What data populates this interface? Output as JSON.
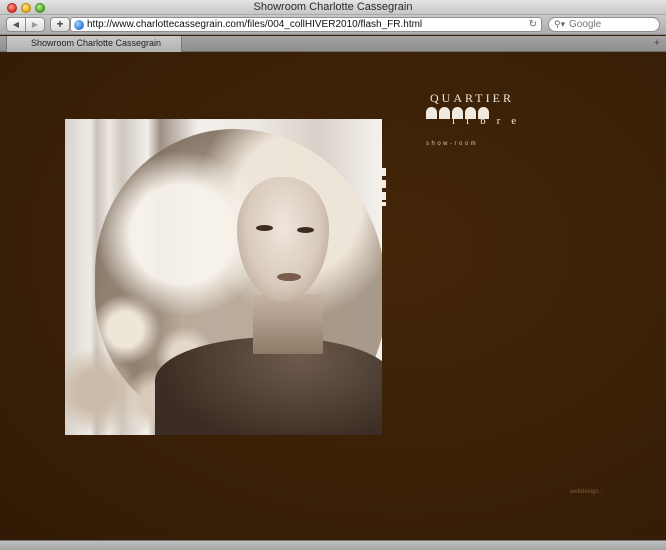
{
  "window": {
    "title": "Showroom Charlotte Cassegrain"
  },
  "toolbar": {
    "back_icon": "back-arrow-icon",
    "forward_icon": "forward-arrow-icon",
    "add_icon": "plus-icon",
    "url": "http://www.charlottecassegrain.com/files/004_collHIVER2010/flash_FR.html",
    "reload_icon": "reload-icon",
    "search_placeholder": "Google"
  },
  "tabs": [
    {
      "label": "Showroom Charlotte Cassegrain",
      "active": true
    }
  ],
  "page": {
    "logo": {
      "top_text": "QUARTIER",
      "bottom_text": "libre",
      "subtitle": "show-room"
    },
    "credit": "webdesign :"
  },
  "colors": {
    "page_background": "#3a2007",
    "logo_text": "#f1e9dd"
  }
}
